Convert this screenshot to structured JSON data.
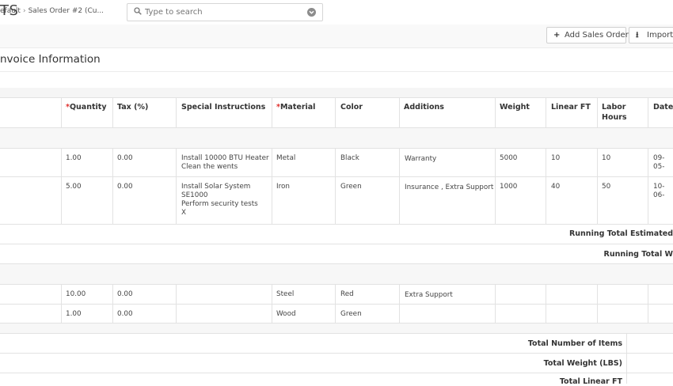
{
  "app": {
    "title_partial": "TS"
  },
  "search": {
    "placeholder": "Type to search"
  },
  "breadcrumb": {
    "first": "efault",
    "second": "Sales Order #2 (Cu..."
  },
  "toolbar": {
    "add_label": "Add Sales Order",
    "import_label": "Import"
  },
  "section": {
    "title": "nvoice Information"
  },
  "table": {
    "headers": {
      "quantity": "Quantity",
      "tax": "Tax (%)",
      "special": "Special Instructions",
      "material": "Material",
      "color": "Color",
      "additions": "Additions",
      "weight": "Weight",
      "linear": "Linear FT",
      "labor": [
        "Labor",
        "Hours"
      ],
      "date": "Date"
    },
    "required_mark": "*",
    "group1": [
      {
        "qty": "1.00",
        "tax": "0.00",
        "special": [
          "Install 10000 BTU Heater",
          "Clean the wents"
        ],
        "material": "Metal",
        "color": "Black",
        "additions": "Warranty",
        "weight": "5000",
        "linear": "10",
        "labor": "10",
        "date": "09-05-"
      },
      {
        "qty": "5.00",
        "tax": "0.00",
        "special": [
          "Install Solar System",
          "SE1000",
          "Perform security tests",
          "X"
        ],
        "material": "Iron",
        "color": "Green",
        "additions": "Insurance , Extra Support",
        "weight": "1000",
        "linear": "40",
        "labor": "50",
        "date": "10-06-"
      }
    ],
    "running_totals": {
      "estimated": "Running Total Estimated",
      "w": "Running Total W"
    },
    "group2": [
      {
        "qty": "10.00",
        "tax": "0.00",
        "special": "",
        "material": "Steel",
        "color": "Red",
        "additions": "Extra Support"
      },
      {
        "qty": "1.00",
        "tax": "0.00",
        "special": "",
        "material": "Wood",
        "color": "Green",
        "additions": ""
      }
    ],
    "totals": {
      "items": "Total Number of Items",
      "weight": "Total Weight (LBS)",
      "linear": "Total Linear FT"
    }
  },
  "colors": {
    "accent_border": "#f0c36d",
    "required": "#e0302d",
    "grid": "#e2e2e2"
  },
  "icons": {
    "search": "search-icon",
    "chevron": "chevron-down-icon",
    "add": "plus-icon",
    "import": "download-icon"
  }
}
